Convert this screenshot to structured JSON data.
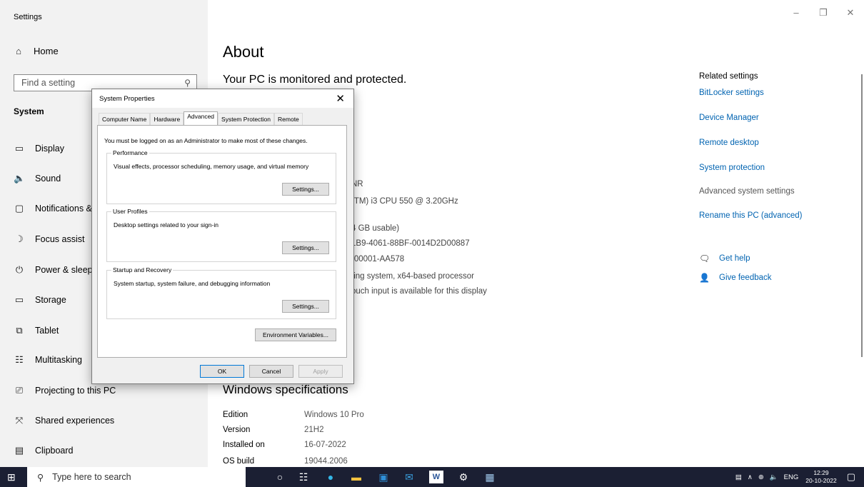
{
  "app": {
    "title": "Settings"
  },
  "window_controls": {
    "minimize": "–",
    "restore": "❐",
    "close": "✕"
  },
  "sidebar": {
    "home_label": "Home",
    "search_placeholder": "Find a setting",
    "section_title": "System",
    "items": [
      {
        "label": "Display",
        "icon": "display-icon",
        "glyph": "🖵"
      },
      {
        "label": "Sound",
        "icon": "sound-icon",
        "glyph": "🔈"
      },
      {
        "label": "Notifications &",
        "icon": "notifications-icon",
        "glyph": "🗨"
      },
      {
        "label": "Focus assist",
        "icon": "focus-assist-icon",
        "glyph": "☽"
      },
      {
        "label": "Power & sleep",
        "icon": "power-icon",
        "glyph": "⏻"
      },
      {
        "label": "Storage",
        "icon": "storage-icon",
        "glyph": "▭"
      },
      {
        "label": "Tablet",
        "icon": "tablet-icon",
        "glyph": "⧉"
      },
      {
        "label": "Multitasking",
        "icon": "multitasking-icon",
        "glyph": "☷"
      },
      {
        "label": "Projecting to this PC",
        "icon": "projecting-icon",
        "glyph": "⎚"
      },
      {
        "label": "Shared experiences",
        "icon": "shared-experiences-icon",
        "glyph": "⤧"
      },
      {
        "label": "Clipboard",
        "icon": "clipboard-icon",
        "glyph": "📋"
      }
    ]
  },
  "main": {
    "title": "About",
    "protected_text": "Your PC is monitored and protected.",
    "device_spec_fragments": [
      "NR",
      "(TM) i3 CPU       550  @ 3.20GHz",
      "4 GB usable)",
      "1B9-4061-88BF-0014D2D00887",
      "-00001-AA578",
      "ting system, x64-based processor",
      "ouch input is available for this display"
    ],
    "windows_specs_title": "Windows specifications",
    "windows_specs": [
      {
        "key": "Edition",
        "value": "Windows 10 Pro"
      },
      {
        "key": "Version",
        "value": "21H2"
      },
      {
        "key": "Installed on",
        "value": "16-07-2022"
      },
      {
        "key": "OS build",
        "value": "19044.2006"
      }
    ]
  },
  "related": {
    "heading": "Related settings",
    "links": [
      "BitLocker settings",
      "Device Manager",
      "Remote desktop",
      "System protection",
      "Advanced system settings",
      "Rename this PC (advanced)"
    ],
    "get_help": "Get help",
    "give_feedback": "Give feedback"
  },
  "dialog": {
    "title": "System Properties",
    "close": "✕",
    "tabs": [
      "Computer Name",
      "Hardware",
      "Advanced",
      "System Protection",
      "Remote"
    ],
    "active_tab": "Advanced",
    "notice": "You must be logged on as an Administrator to make most of these changes.",
    "performance": {
      "legend": "Performance",
      "text": "Visual effects, processor scheduling, memory usage, and virtual memory",
      "button": "Settings..."
    },
    "user_profiles": {
      "legend": "User Profiles",
      "text": "Desktop settings related to your sign-in",
      "button": "Settings..."
    },
    "startup": {
      "legend": "Startup and Recovery",
      "text": "System startup, system failure, and debugging information",
      "button": "Settings..."
    },
    "env_button": "Environment Variables...",
    "ok": "OK",
    "cancel": "Cancel",
    "apply": "Apply"
  },
  "taskbar": {
    "search_placeholder": "Type here to search",
    "language": "ENG",
    "time": "12:29",
    "date": "20-10-2022"
  }
}
